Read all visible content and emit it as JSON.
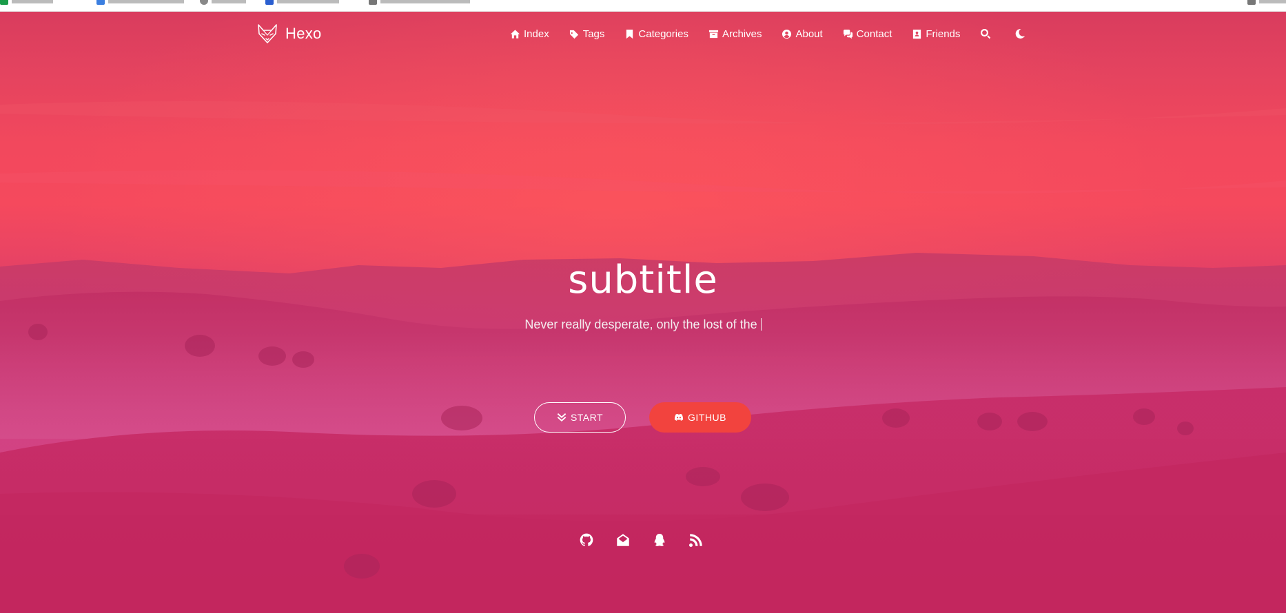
{
  "site": {
    "brand": "Hexo"
  },
  "nav": {
    "items": [
      {
        "label": "Index",
        "icon": "home-icon"
      },
      {
        "label": "Tags",
        "icon": "tags-icon"
      },
      {
        "label": "Categories",
        "icon": "bookmark-icon"
      },
      {
        "label": "Archives",
        "icon": "archive-icon"
      },
      {
        "label": "About",
        "icon": "user-circle-icon"
      },
      {
        "label": "Contact",
        "icon": "comments-icon"
      },
      {
        "label": "Friends",
        "icon": "address-book-icon"
      }
    ],
    "search_icon": "search-icon",
    "dark_mode_icon": "moon-icon"
  },
  "hero": {
    "title": "subtitle",
    "tagline": "Never really desperate, only the lost of the",
    "start_button": "START",
    "github_button": "GITHUB"
  },
  "social": [
    {
      "icon": "github-icon"
    },
    {
      "icon": "envelope-open-icon"
    },
    {
      "icon": "qq-icon"
    },
    {
      "icon": "rss-icon"
    }
  ],
  "colors": {
    "hero_top": "#d93c5e",
    "hero_mid": "#f5495d",
    "hero_bottom": "#c52a63",
    "github_button": "#f2433e",
    "text": "#ffffff"
  }
}
